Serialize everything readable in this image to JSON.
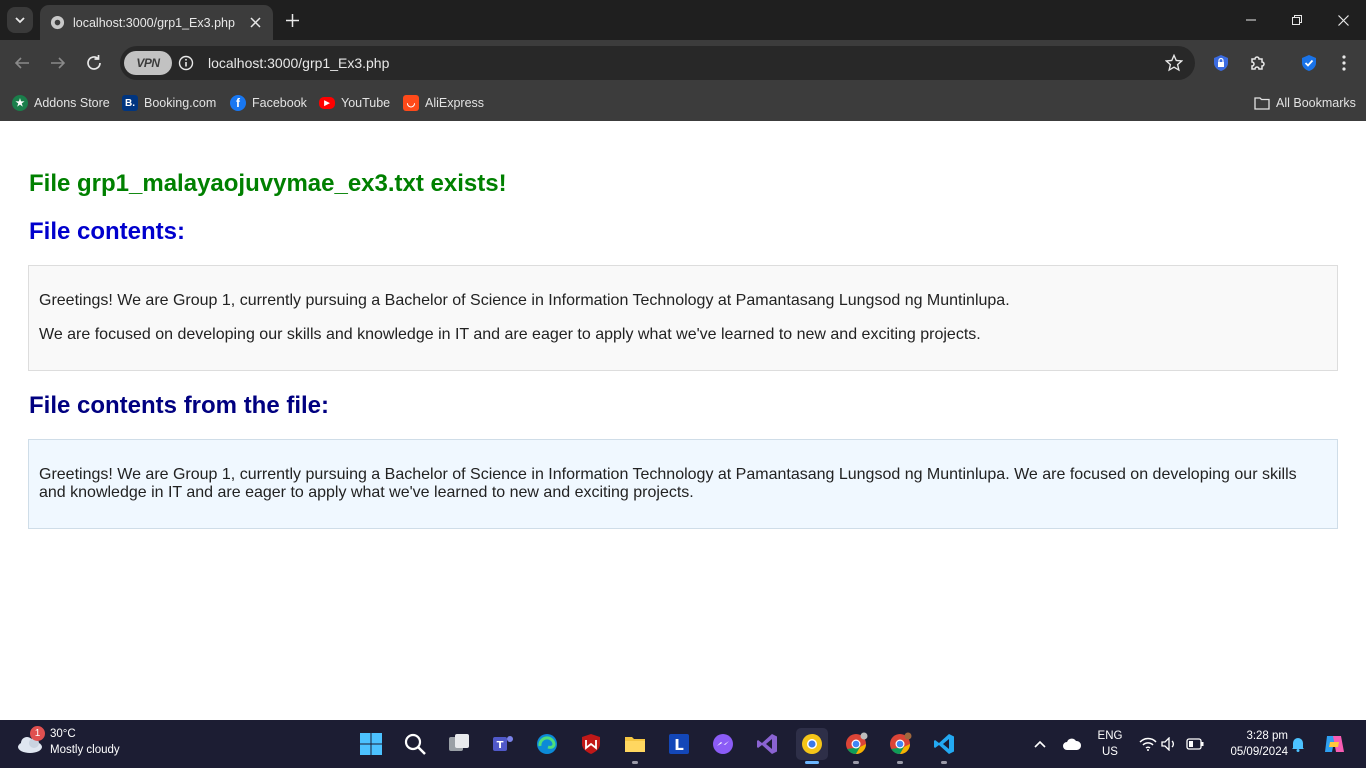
{
  "browser": {
    "tab_title": "localhost:3000/grp1_Ex3.php",
    "url": "localhost:3000/grp1_Ex3.php",
    "vpn_label": "VPN",
    "bookmarks": [
      {
        "label": "Addons Store",
        "icon": "addons-store-icon",
        "color": "#1a7f4b",
        "glyph": "★"
      },
      {
        "label": "Booking.com",
        "icon": "booking-icon",
        "color": "#003580",
        "glyph": "B."
      },
      {
        "label": "Facebook",
        "icon": "facebook-icon",
        "color": "#1877f2",
        "glyph": "f"
      },
      {
        "label": "YouTube",
        "icon": "youtube-icon",
        "color": "#ff0000",
        "glyph": "▶"
      },
      {
        "label": "AliExpress",
        "icon": "aliexpress-icon",
        "color": "#ff4a1a",
        "glyph": "◡"
      }
    ],
    "all_bookmarks": "All Bookmarks"
  },
  "page": {
    "heading_exists": "File grp1_malayaojuvymae_ex3.txt exists!",
    "heading_contents": "File contents:",
    "contents_para1": "Greetings! We are Group 1, currently pursuing a Bachelor of Science in Information Technology at Pamantasang Lungsod ng Muntinlupa.",
    "contents_para2": "We are focused on developing our skills and knowledge in IT and are eager to apply what we've learned to new and exciting projects.",
    "heading_from_file": "File contents from the file:",
    "from_file_text": "Greetings! We are Group 1, currently pursuing a Bachelor of Science in Information Technology at Pamantasang Lungsod ng Muntinlupa. We are focused on developing our skills and knowledge in IT and are eager to apply what we've learned to new and exciting projects.",
    "colors": {
      "exists": "#008000",
      "contents": "#0000cd",
      "from_file": "#000080"
    }
  },
  "taskbar": {
    "weather_badge": "1",
    "temperature": "30°C",
    "condition": "Mostly cloudy",
    "language": "ENG",
    "region": "US",
    "time": "3:28 pm",
    "date": "05/09/2024"
  }
}
